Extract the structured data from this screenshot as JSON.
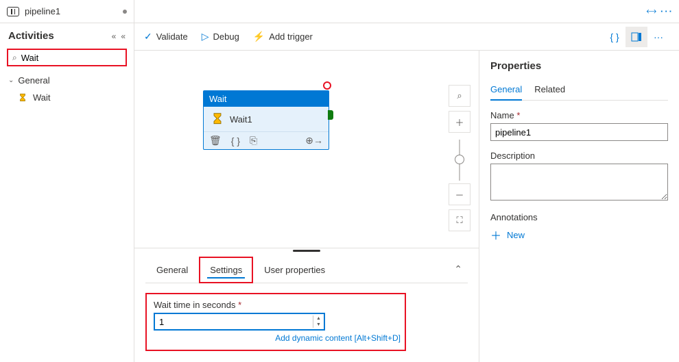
{
  "tab": {
    "name": "pipeline1",
    "dirty": true
  },
  "sidebar": {
    "title": "Activities",
    "search_value": "Wait",
    "categories": [
      {
        "label": "General",
        "expanded": true
      }
    ],
    "items": [
      {
        "label": "Wait",
        "icon": "hourglass-icon"
      }
    ]
  },
  "toolbar": {
    "validate": "Validate",
    "debug": "Debug",
    "add_trigger": "Add trigger"
  },
  "canvas": {
    "node": {
      "type_label": "Wait",
      "name": "Wait1"
    }
  },
  "bottom_panel": {
    "tabs": {
      "general": "General",
      "settings": "Settings",
      "user_props": "User properties"
    },
    "active_tab": "settings",
    "wait_label": "Wait time in seconds",
    "wait_value": "1",
    "dyn_link": "Add dynamic content [Alt+Shift+D]"
  },
  "properties": {
    "title": "Properties",
    "tabs": {
      "general": "General",
      "related": "Related"
    },
    "name_label": "Name",
    "name_value": "pipeline1",
    "desc_label": "Description",
    "desc_value": "",
    "annot_label": "Annotations",
    "new_label": "New"
  }
}
